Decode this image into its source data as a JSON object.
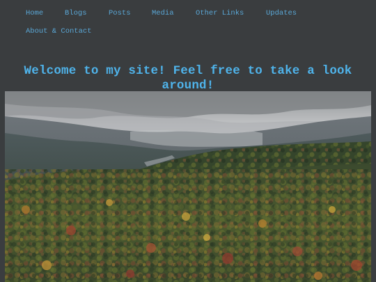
{
  "nav": {
    "items": [
      {
        "label": "Home"
      },
      {
        "label": "Blogs"
      },
      {
        "label": "Posts"
      },
      {
        "label": "Media"
      },
      {
        "label": "Other Links"
      },
      {
        "label": "Updates"
      },
      {
        "label": "About & Contact"
      }
    ]
  },
  "main": {
    "title": "Welcome to my site! Feel free to take a look around!"
  },
  "colors": {
    "background": "#3a3d3f",
    "nav_link": "#5aa7d6",
    "title": "#4fb3ea"
  }
}
